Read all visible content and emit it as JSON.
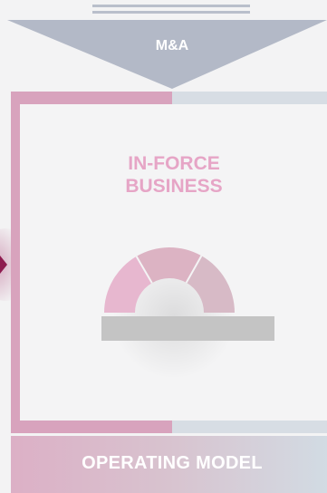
{
  "diagram": {
    "top_arrow": {
      "label": "M&A"
    },
    "central_box": {
      "label_line1": "IN-FORCE",
      "label_line2": "BUSINESS"
    },
    "bottom_band": {
      "label": "OPERATING MODEL"
    }
  },
  "colors": {
    "background": "#f3f3f4",
    "pink": "#d8a3bd",
    "light_blue_grey": "#d7dde4",
    "arrow_grey": "#b3b9c7",
    "label_pink": "#e6a5c6",
    "gauge_left": "#e7b7cf",
    "gauge_mid": "#dcb3c3",
    "gauge_right": "#d7bac6",
    "base_bar": "#c4c4c4"
  }
}
